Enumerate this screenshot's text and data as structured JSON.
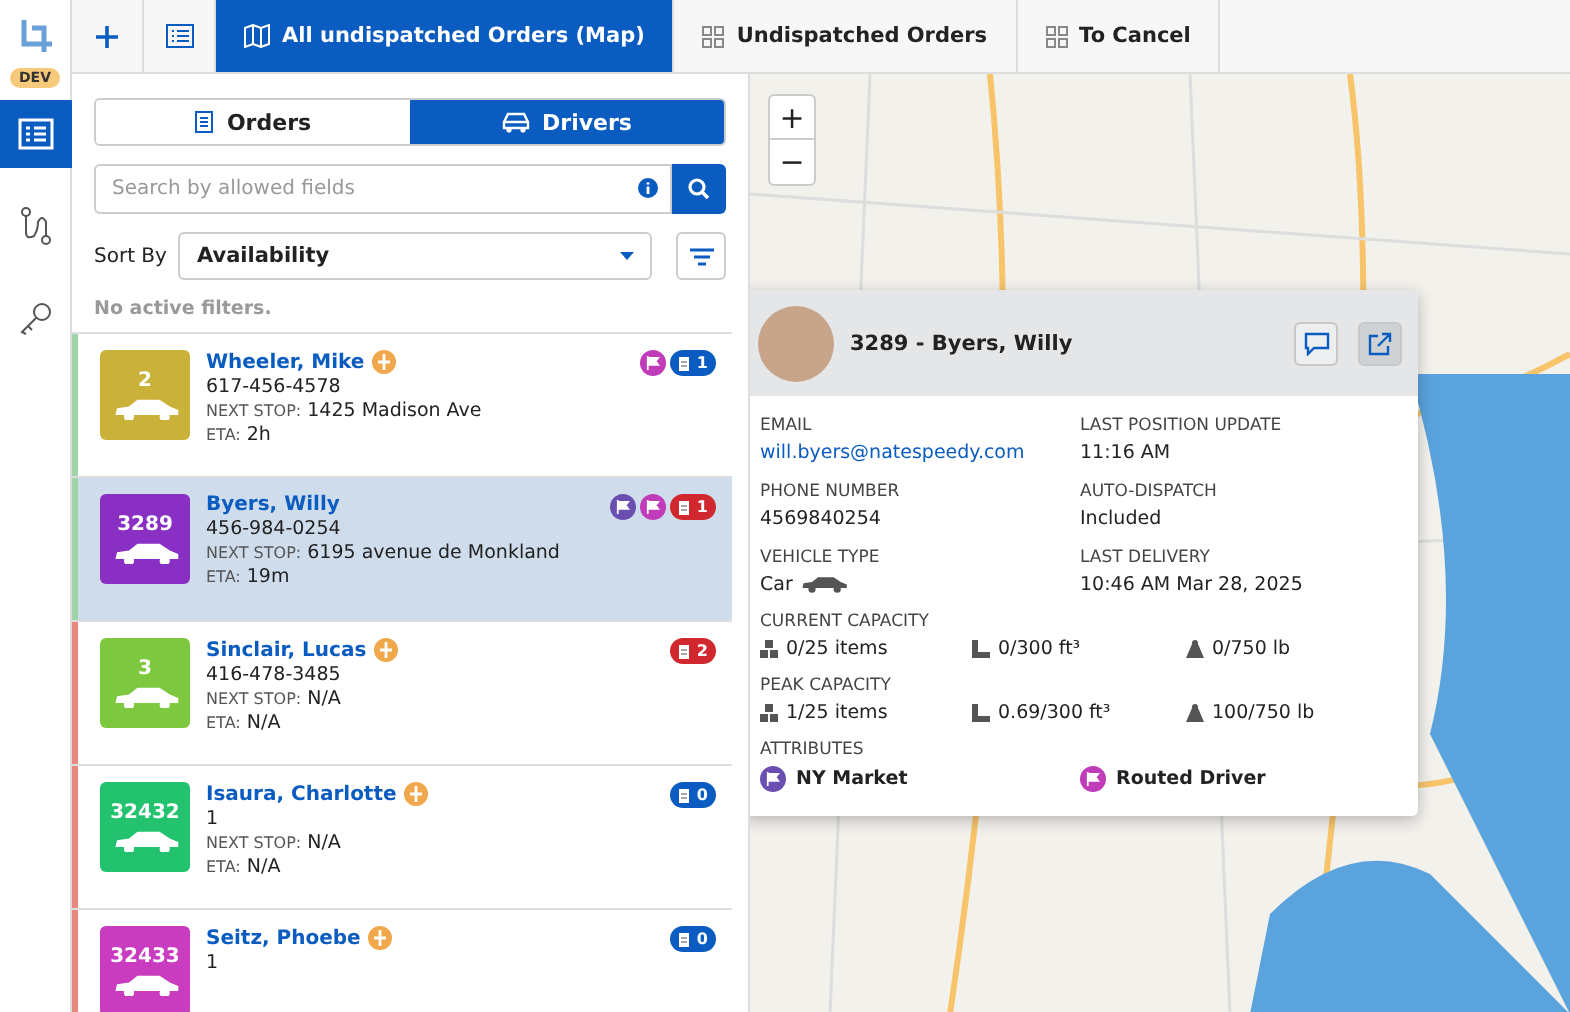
{
  "rail": {
    "badge": "DEV",
    "items": [
      {
        "kind": "list",
        "selected": true
      },
      {
        "kind": "route",
        "selected": false
      },
      {
        "kind": "key",
        "selected": false
      }
    ]
  },
  "tabs": [
    {
      "kind": "add",
      "selected": false
    },
    {
      "kind": "list",
      "selected": false
    },
    {
      "kind": "map",
      "label": "All undispatched Orders (Map)",
      "selected": true
    },
    {
      "kind": "grid",
      "label": "Undispatched Orders",
      "selected": false
    },
    {
      "kind": "grid",
      "label": "To Cancel",
      "selected": false
    }
  ],
  "toggle": [
    {
      "kind": "orders",
      "label": "Orders",
      "selected": false
    },
    {
      "kind": "drivers",
      "label": "Drivers",
      "selected": true
    }
  ],
  "search": {
    "placeholder": "Search by allowed fields"
  },
  "sort": {
    "label": "Sort By",
    "value": "Availability"
  },
  "filters_note": "No active filters.",
  "drivers": [
    {
      "number": "2",
      "color": "#c9b13a",
      "status": {
        "color": "#9fd3a8"
      },
      "name": "Wheeler, Mike",
      "phone": "617-456-4578",
      "next_stop_label": "NEXT STOP:",
      "next_stop": "1425 Madison Ave",
      "eta_label": "ETA:",
      "eta": "2h",
      "selected": false,
      "flags": [
        {
          "color": "#c03cb8"
        }
      ],
      "count": {
        "value": "1",
        "color": "#0b5cc0"
      }
    },
    {
      "number": "3289",
      "color": "#8a2fc4",
      "status": {
        "color": "#9fd3a8"
      },
      "name": "Byers, Willy",
      "phone": "456-984-0254",
      "next_stop_label": "NEXT STOP:",
      "next_stop": "6195 avenue de Monkland",
      "eta_label": "ETA:",
      "eta": "19m",
      "selected": true,
      "flags": [
        {
          "color": "#6b4fb0"
        },
        {
          "color": "#c03cb8"
        }
      ],
      "count": {
        "value": "1",
        "color": "#d0282e"
      }
    },
    {
      "number": "3",
      "color": "#7ec840",
      "status": {
        "color": "#e8887c"
      },
      "name": "Sinclair, Lucas",
      "phone": "416-478-3485",
      "next_stop_label": "NEXT STOP:",
      "next_stop": "N/A",
      "eta_label": "ETA:",
      "eta": "N/A",
      "selected": false,
      "count": {
        "value": "2",
        "color": "#d0282e"
      }
    },
    {
      "number": "32432",
      "color": "#22c26e",
      "status": {
        "color": "#e8887c"
      },
      "name": "Isaura, Charlotte",
      "phone": "1",
      "next_stop_label": "NEXT STOP:",
      "next_stop": "N/A",
      "eta_label": "ETA:",
      "eta": "N/A",
      "selected": false,
      "count": {
        "value": "0",
        "color": "#0b5cc0"
      }
    },
    {
      "number": "32433",
      "color": "#c93cc0",
      "status": {
        "color": "#e8887c"
      },
      "name": "Seitz, Phoebe",
      "phone": "1",
      "selected": false,
      "count": {
        "value": "0",
        "color": "#0b5cc0"
      }
    }
  ],
  "map": {
    "zoom_in": "+",
    "zoom_out": "−"
  },
  "popup": {
    "title": "3289 - Byers, Willy",
    "fields": [
      {
        "label": "EMAIL",
        "value": "will.byers@natespeedy.com",
        "kind": "link"
      },
      {
        "label": "LAST POSITION UPDATE",
        "value": "11:16 AM",
        "kind": "text"
      },
      {
        "label": "PHONE NUMBER",
        "value": "4569840254",
        "kind": "text"
      },
      {
        "label": "AUTO-DISPATCH",
        "value": "Included",
        "kind": "text"
      },
      {
        "label": "VEHICLE TYPE",
        "value": "Car",
        "kind": "vehicle"
      },
      {
        "label": "LAST DELIVERY",
        "value": "10:46 AM Mar 28, 2025",
        "kind": "text"
      }
    ],
    "capacities": [
      {
        "label": "CURRENT CAPACITY",
        "items": [
          {
            "kind": "items",
            "text": "0/25 items"
          },
          {
            "kind": "volume",
            "text": "0/300 ft³"
          },
          {
            "kind": "weight",
            "text": "0/750 lb"
          }
        ]
      },
      {
        "label": "PEAK CAPACITY",
        "items": [
          {
            "kind": "items",
            "text": "1/25 items"
          },
          {
            "kind": "volume",
            "text": "0.69/300 ft³"
          },
          {
            "kind": "weight",
            "text": "100/750 lb"
          }
        ]
      }
    ],
    "attributes_label": "ATTRIBUTES",
    "attributes": [
      {
        "label": "NY Market",
        "color": "#6b4fb0"
      },
      {
        "label": "Routed Driver",
        "color": "#c03cb8"
      }
    ]
  }
}
